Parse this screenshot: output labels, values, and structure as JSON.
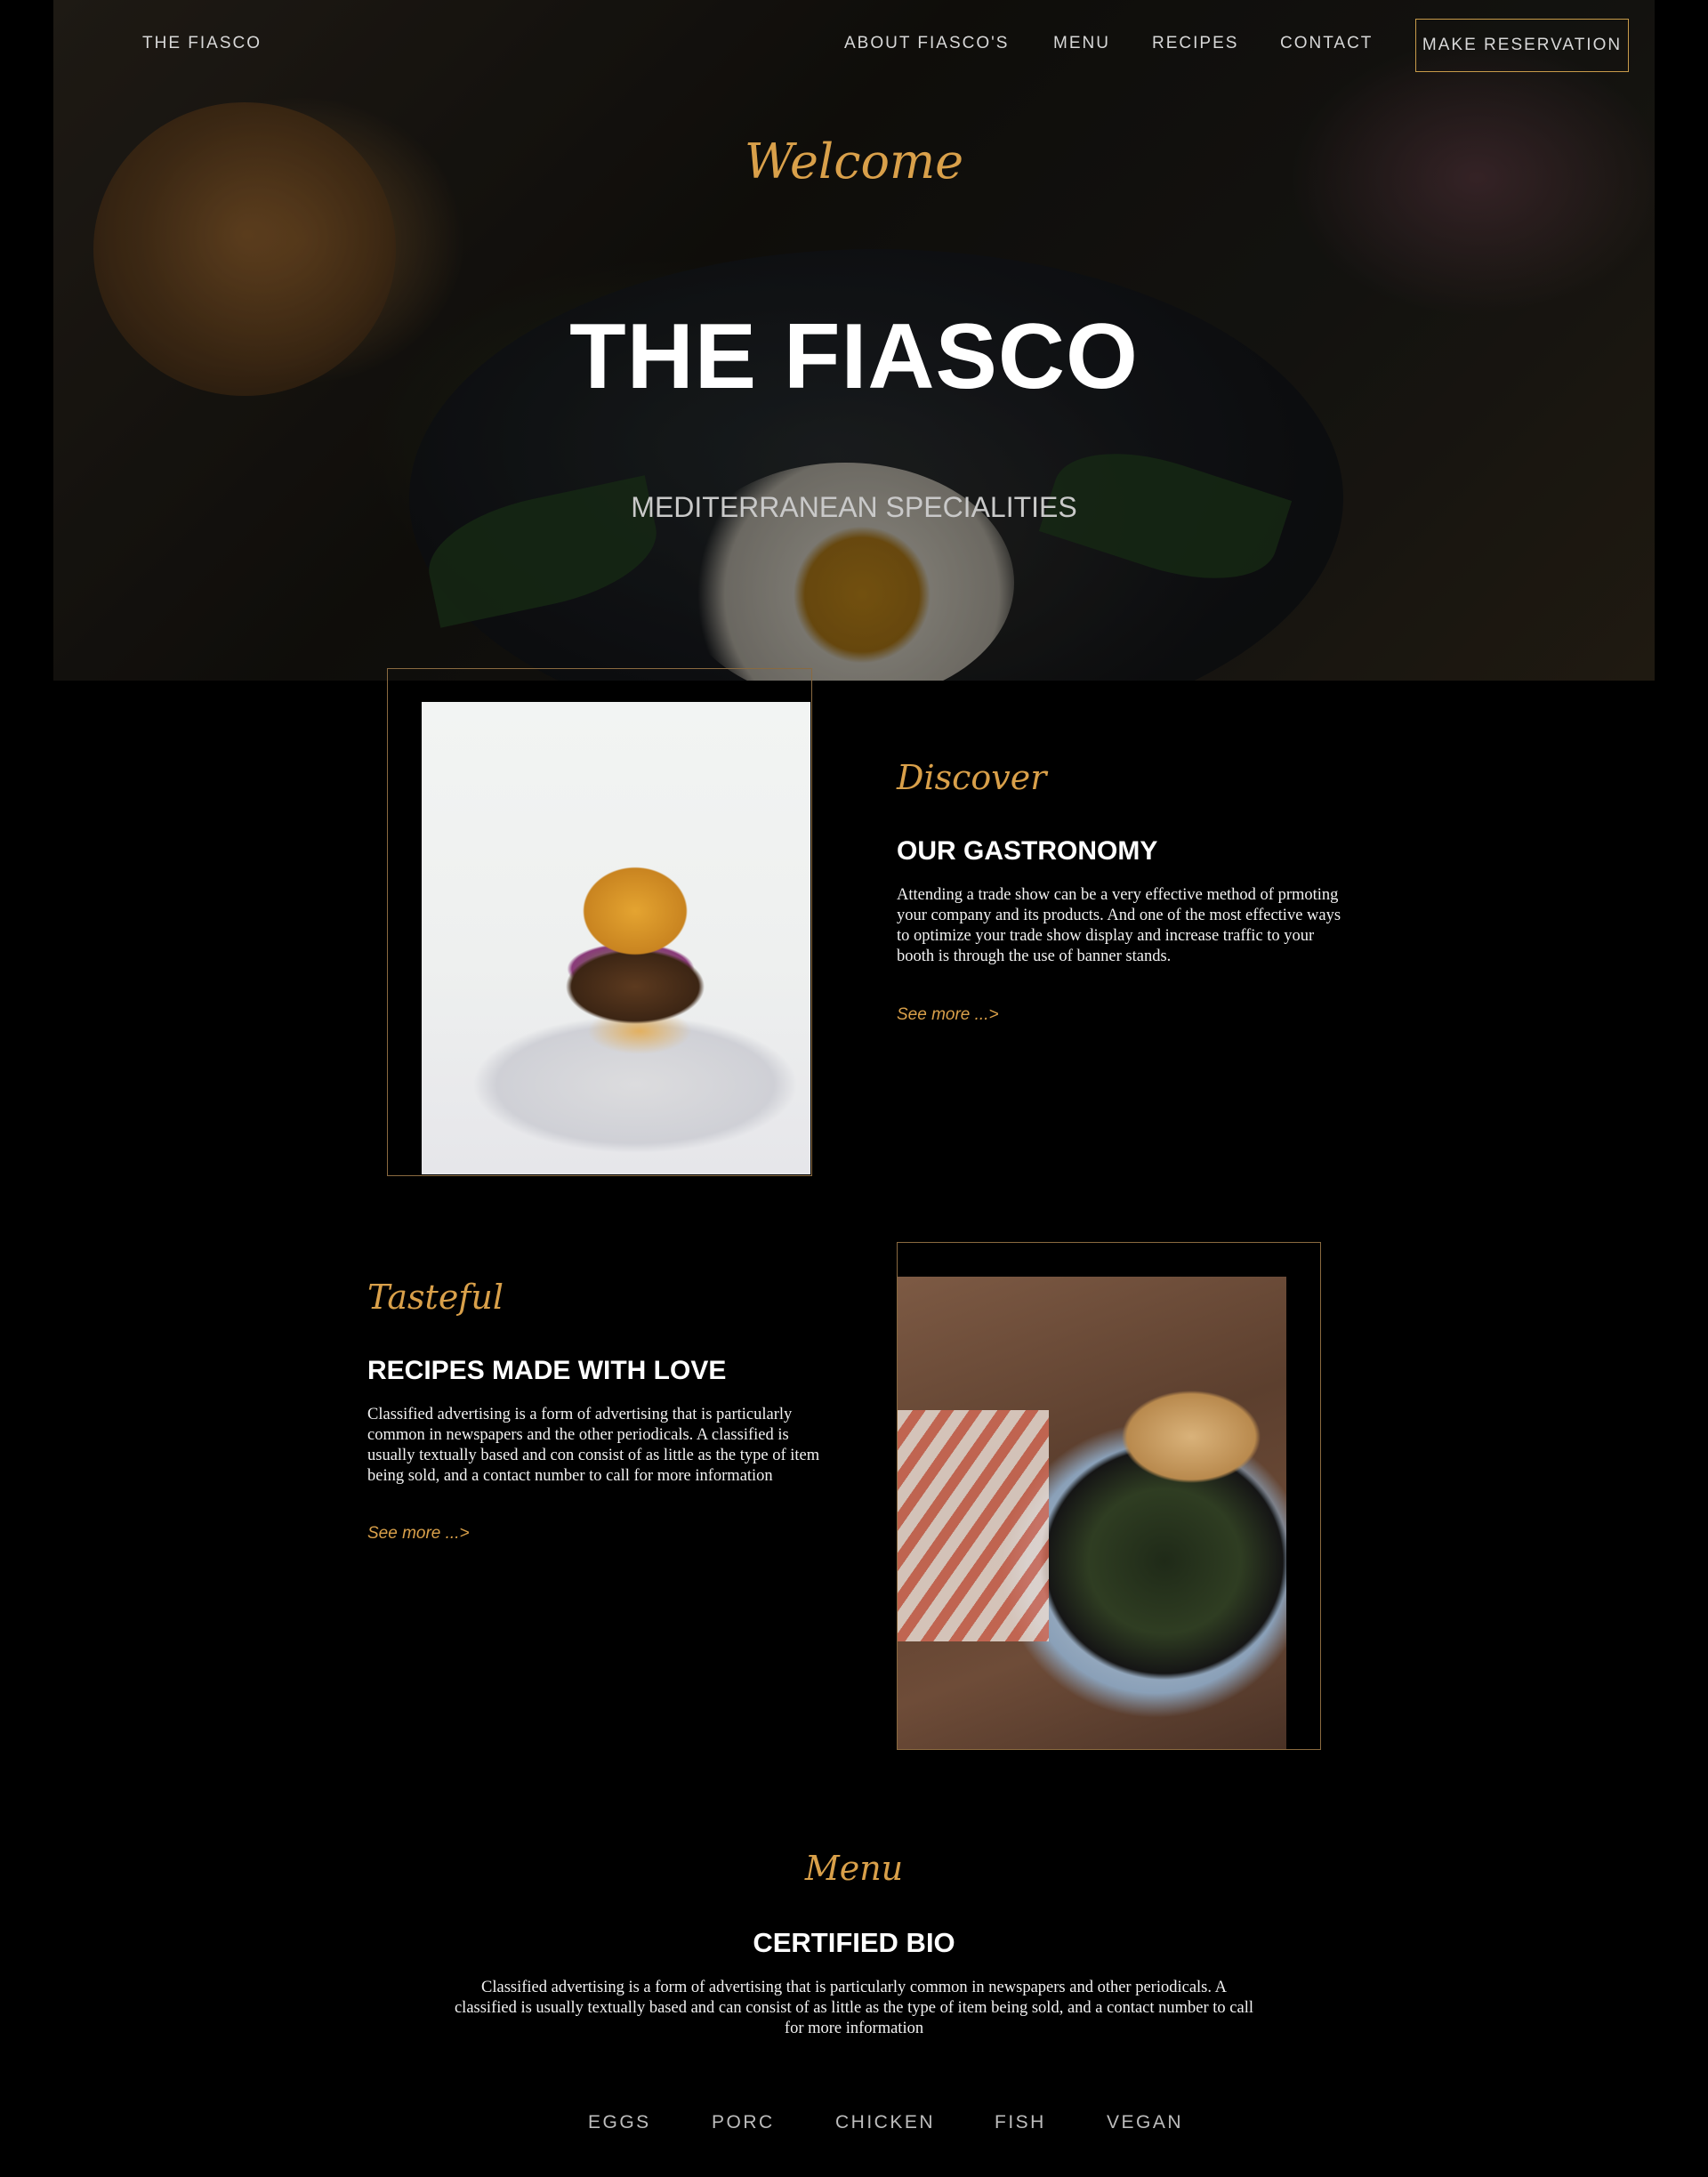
{
  "nav": {
    "brand": "THE FIASCO",
    "links": [
      "ABOUT FIASCO'S",
      "MENU",
      "RECIPES",
      "CONTACT"
    ],
    "cta": "MAKE RESERVATION"
  },
  "hero": {
    "kicker": "Welcome",
    "title": "THE FIASCO",
    "subtitle": "MEDITERRANEAN SPECIALITIES"
  },
  "gastronomy": {
    "kicker": "Discover",
    "heading": "OUR GASTRONOMY",
    "body": "Attending a trade show can be a very effective method of prmoting your company and its products. And one of the most effective ways to optimize your trade show display and increase traffic to your booth is through the use of banner stands.",
    "link": "See more ...>"
  },
  "recipes": {
    "kicker": "Tasteful",
    "heading": "RECIPES MADE WITH LOVE",
    "body": "Classified advertising is a form of advertising that is particularly common in newspapers and the other periodicals. A classified is usually textually based and con consist of as little as the type of item being sold, and a contact number to call for more information",
    "link": "See more ...>"
  },
  "menu": {
    "kicker": "Menu",
    "heading": "CERTIFIED BIO",
    "body": "Classified advertising is a form of advertising that is particularly common in newspapers and other periodicals. A classified is usually textually based and can consist of as little as the type of item being sold, and a contact number to call for more information",
    "tabs": [
      "EGGS",
      "PORC",
      "CHICKEN",
      "FISH",
      "VEGAN"
    ]
  },
  "colors": {
    "accent": "#d9a04a",
    "frame": "#8a6a40",
    "background": "#000000"
  }
}
